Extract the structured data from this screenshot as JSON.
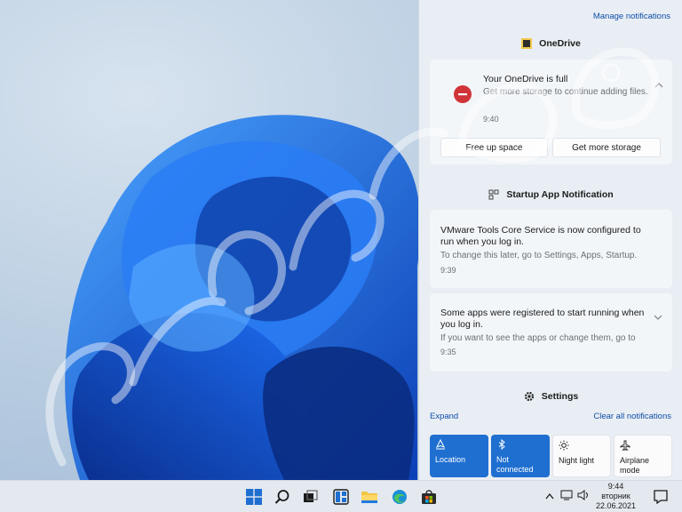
{
  "action_center": {
    "manage_label": "Manage notifications",
    "onedrive": {
      "app_name": "OneDrive",
      "title": "Your OneDrive is full",
      "body": "Get more storage to continue adding files.",
      "time": "9:40",
      "buttons": [
        "Free up space",
        "Get more storage"
      ]
    },
    "startup": {
      "app_name": "Startup App Notification",
      "notifications": [
        {
          "title": "VMware Tools Core Service is now configured to run when you log in.",
          "body": "To change this later, go to Settings, Apps, Startup.",
          "time": "9:39"
        },
        {
          "title": "Some apps were registered to start running when you log in.",
          "body": "If you want to see the apps or change them, go to",
          "time": "9:35"
        }
      ]
    },
    "settings_header": "Settings",
    "expand_label": "Expand",
    "clear_label": "Clear all notifications",
    "quick_actions": [
      {
        "label": "Location",
        "state": "on",
        "icon": "location-icon"
      },
      {
        "label": "Not connected",
        "state": "on",
        "icon": "bluetooth-icon"
      },
      {
        "label": "Night light",
        "state": "off",
        "icon": "brightness-icon"
      },
      {
        "label": "Airplane mode",
        "state": "off",
        "icon": "airplane-icon"
      }
    ]
  },
  "taskbar": {
    "pinned": [
      "windows-start-icon",
      "search-icon",
      "task-view-icon",
      "widgets-icon",
      "file-explorer-icon",
      "edge-icon",
      "store-icon"
    ],
    "clock": {
      "time": "9:44",
      "day": "вторник",
      "date": "22.06.2021"
    }
  },
  "colors": {
    "accent": "#1f6fd0",
    "link": "#0f4ea8",
    "error": "#d13438"
  }
}
